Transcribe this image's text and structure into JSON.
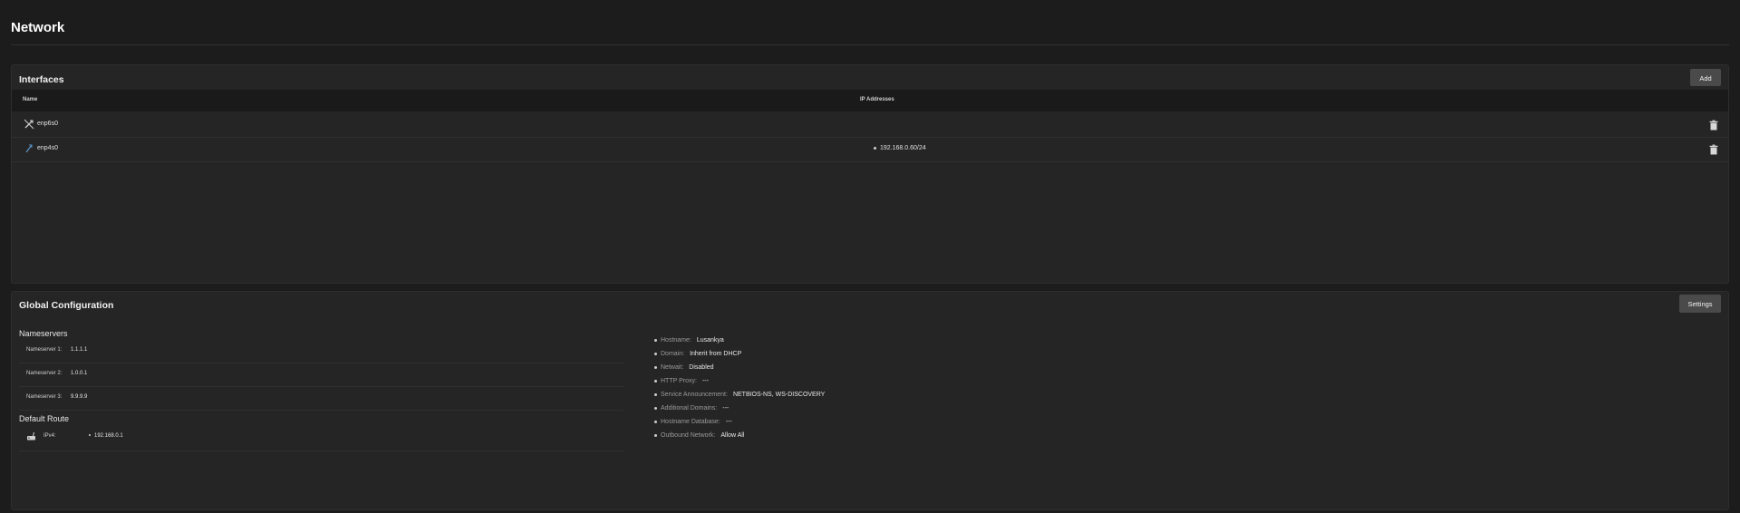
{
  "page": {
    "title": "Network"
  },
  "interfaces": {
    "title": "Interfaces",
    "add_label": "Add",
    "columns": {
      "name": "Name",
      "ip": "IP Addresses"
    },
    "rows": [
      {
        "name": "enp6s0",
        "ip": "",
        "icon": "link-disconnected-icon"
      },
      {
        "name": "enp4s0",
        "ip": "192.168.0.60/24",
        "icon": "link-connected-icon"
      }
    ]
  },
  "global": {
    "title": "Global Configuration",
    "settings_label": "Settings",
    "nameservers": {
      "heading": "Nameservers",
      "items": [
        {
          "label": "Nameserver 1:",
          "value": "1.1.1.1"
        },
        {
          "label": "Nameserver 2:",
          "value": "1.0.0.1"
        },
        {
          "label": "Nameserver 3:",
          "value": "9.9.9.9"
        }
      ]
    },
    "default_route": {
      "heading": "Default Route",
      "label": "IPv4:",
      "value": "192.168.0.1"
    },
    "info": [
      {
        "label": "Hostname:",
        "value": "Lusankya"
      },
      {
        "label": "Domain:",
        "value": "Inherit from DHCP"
      },
      {
        "label": "Netwait:",
        "value": "Disabled"
      },
      {
        "label": "HTTP Proxy:",
        "value": "---"
      },
      {
        "label": "Service Announcement:",
        "value": "NETBIOS-NS, WS-DISCOVERY"
      },
      {
        "label": "Additional Domains:",
        "value": "---"
      },
      {
        "label": "Hostname Database:",
        "value": "---"
      },
      {
        "label": "Outbound Network:",
        "value": "Allow All"
      }
    ]
  }
}
